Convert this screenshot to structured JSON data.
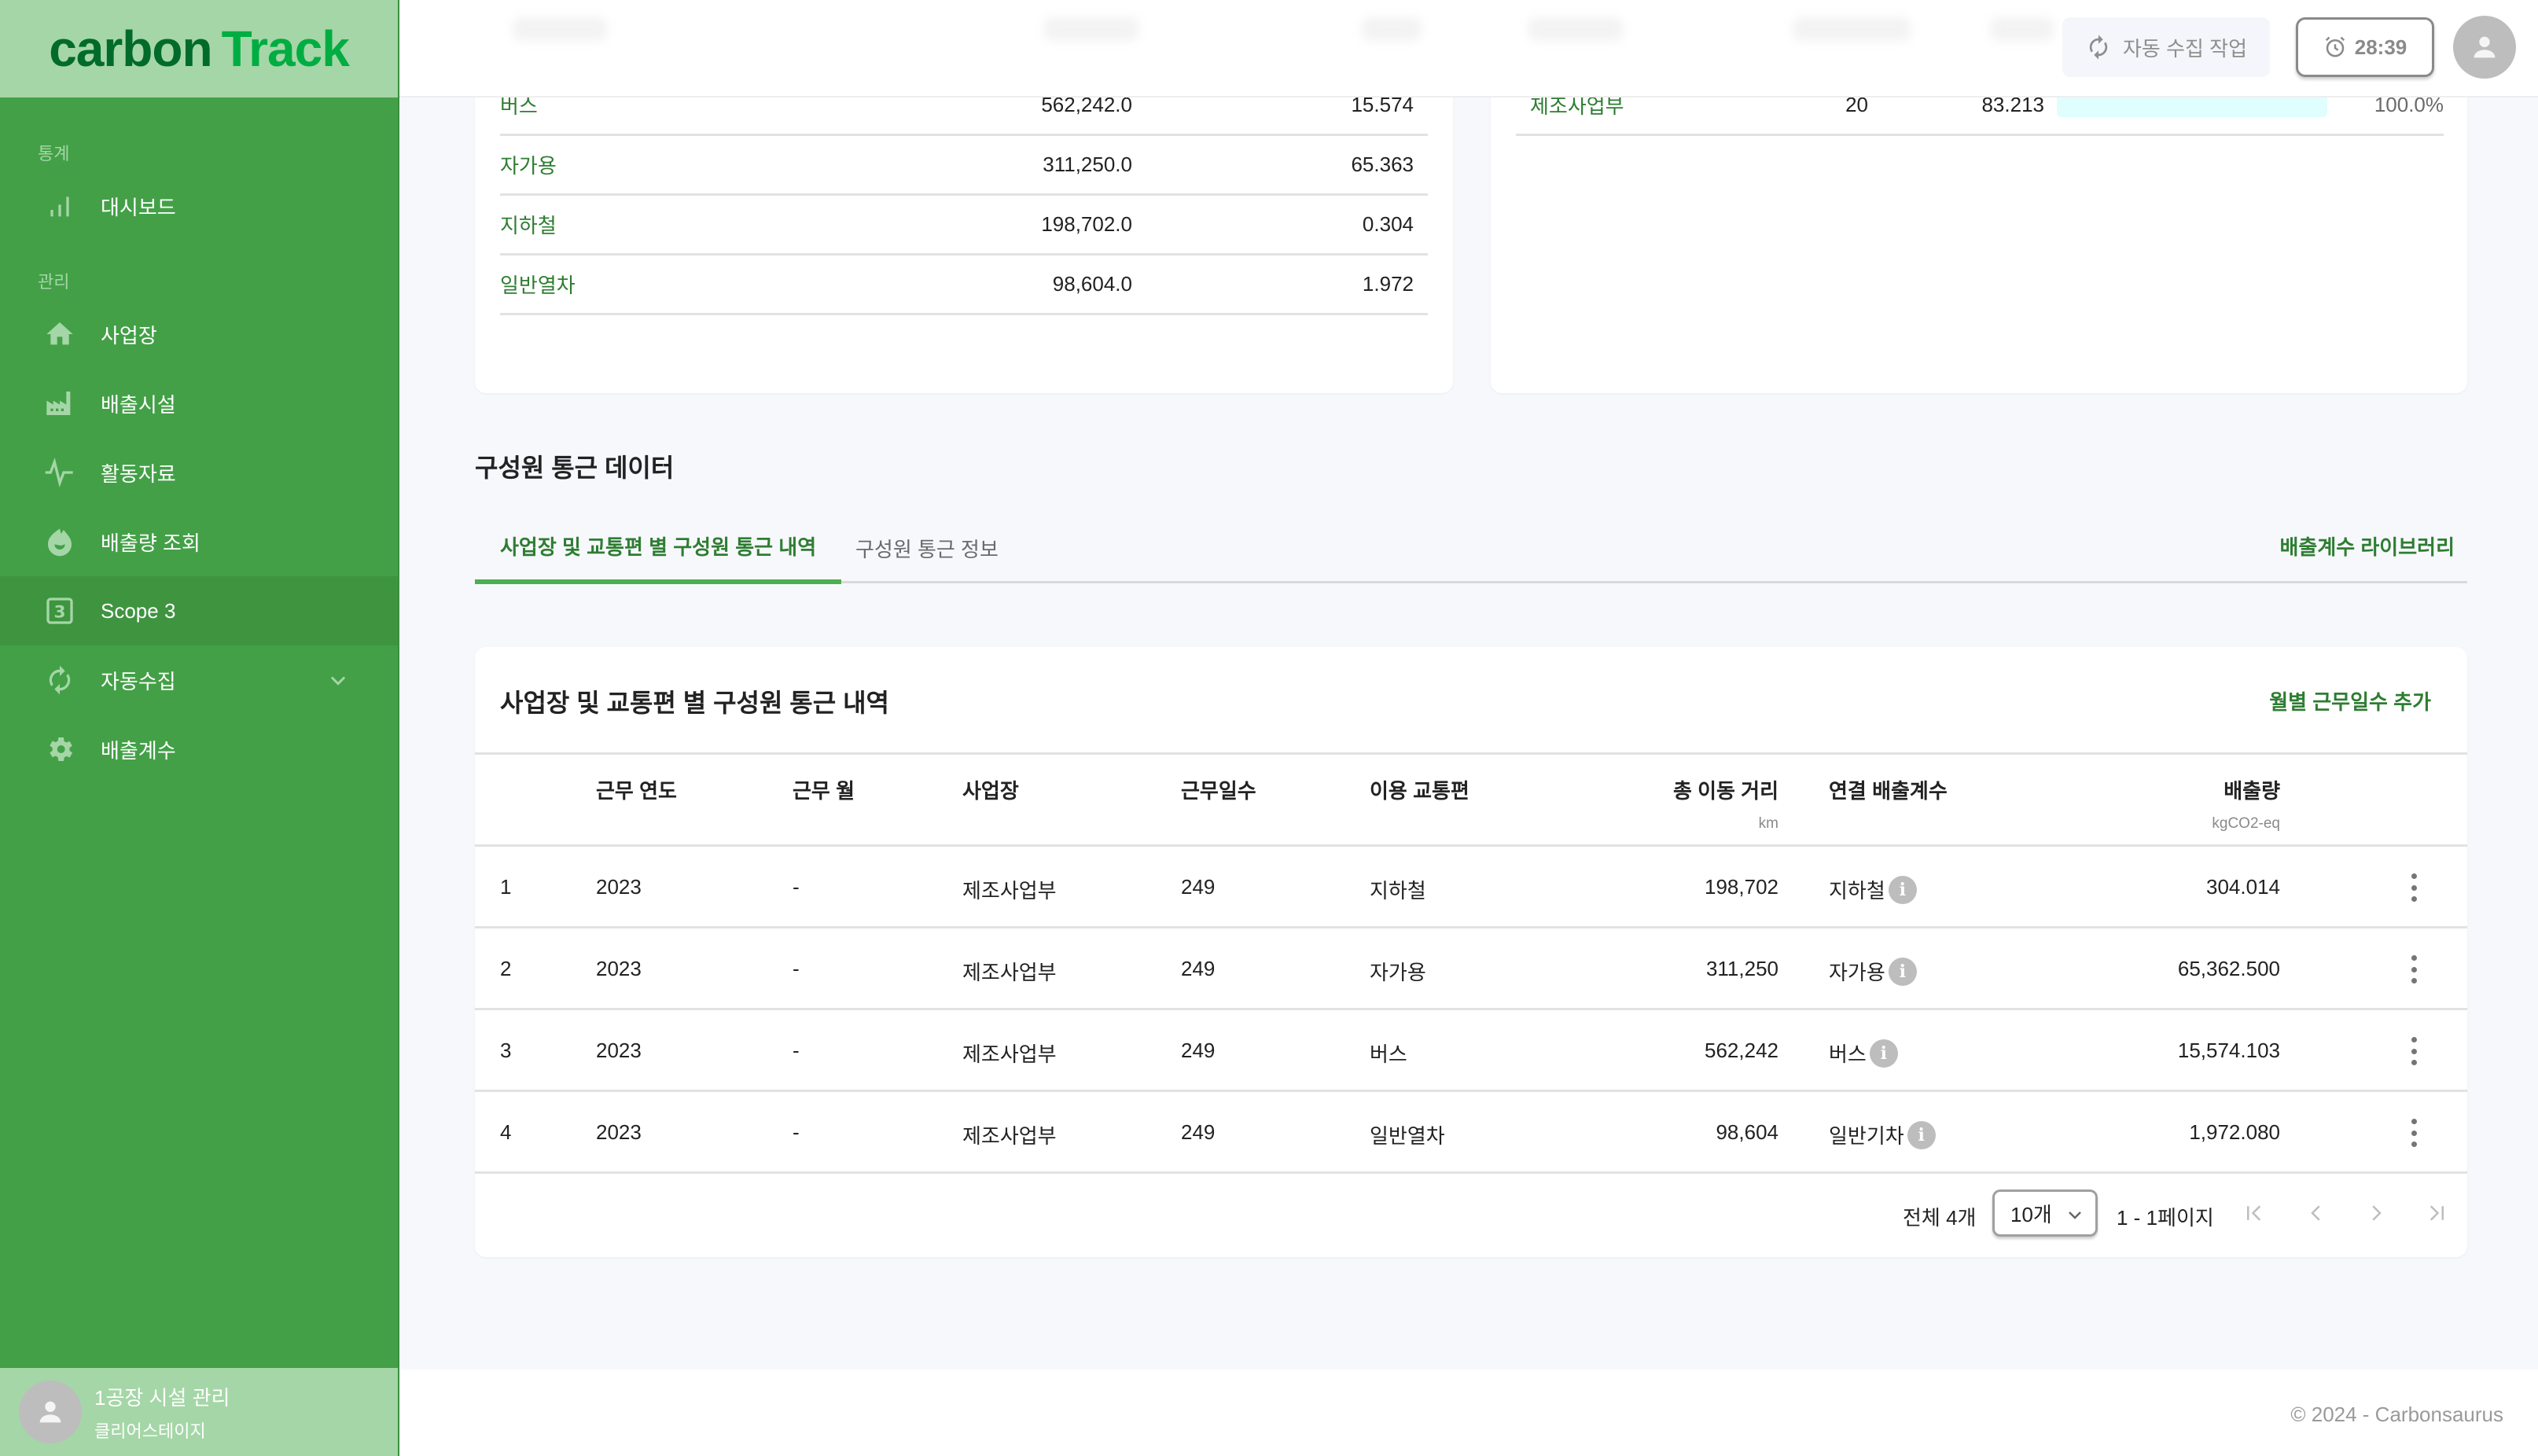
{
  "brand": {
    "part1": "carbon",
    "part2": "Track"
  },
  "sidebar": {
    "sections": [
      {
        "label": "통계"
      },
      {
        "label": "관리"
      }
    ],
    "items": [
      {
        "label": "대시보드",
        "icon": "bar-chart-icon"
      },
      {
        "label": "사업장",
        "icon": "home-icon"
      },
      {
        "label": "배출시설",
        "icon": "factory-icon"
      },
      {
        "label": "활동자료",
        "icon": "activity-icon"
      },
      {
        "label": "배출량 조회",
        "icon": "fire-icon"
      },
      {
        "label": "Scope 3",
        "icon": "scope3-icon",
        "active": true
      },
      {
        "label": "자동수집",
        "icon": "sync-icon",
        "expandable": true
      },
      {
        "label": "배출계수",
        "icon": "gear-icon"
      }
    ],
    "user": {
      "name": "1공장 시설 관리",
      "org": "클리어스테이지"
    }
  },
  "topbar": {
    "auto_collect_label": "자동 수집 작업",
    "timer": "28:39"
  },
  "transport_summary": {
    "rows": [
      {
        "mode": "버스",
        "distance": "562,242.0",
        "emission": "15.574"
      },
      {
        "mode": "자가용",
        "distance": "311,250.0",
        "emission": "65.363"
      },
      {
        "mode": "지하철",
        "distance": "198,702.0",
        "emission": "0.304"
      },
      {
        "mode": "일반열차",
        "distance": "98,604.0",
        "emission": "1.972"
      }
    ]
  },
  "site_summary": {
    "rows": [
      {
        "site": "제조사업부",
        "count": "20",
        "emission": "83.213",
        "share": 100.0,
        "share_label": "100.0%"
      }
    ],
    "bar_color": "#dffefd"
  },
  "section": {
    "title": "구성원 통근 데이터",
    "tabs": [
      {
        "label": "사업장 및 교통편 별 구성원 통근 내역",
        "active": true
      },
      {
        "label": "구성원 통근 정보",
        "active": false
      }
    ],
    "library_link": "배출계수 라이브러리"
  },
  "commute_table": {
    "title": "사업장 및 교통편 별 구성원 통근 내역",
    "add_button": "월별 근무일수 추가",
    "columns": [
      {
        "label": "근무 연도"
      },
      {
        "label": "근무 월"
      },
      {
        "label": "사업장"
      },
      {
        "label": "근무일수"
      },
      {
        "label": "이용 교통편"
      },
      {
        "label": "총 이동 거리",
        "unit": "km"
      },
      {
        "label": "연결 배출계수"
      },
      {
        "label": "배출량",
        "unit": "kgCO2-eq"
      }
    ],
    "rows": [
      {
        "no": "1",
        "year": "2023",
        "month": "-",
        "site": "제조사업부",
        "days": "249",
        "mode": "지하철",
        "distance": "198,702",
        "factor": "지하철",
        "emission": "304.014"
      },
      {
        "no": "2",
        "year": "2023",
        "month": "-",
        "site": "제조사업부",
        "days": "249",
        "mode": "자가용",
        "distance": "311,250",
        "factor": "자가용",
        "emission": "65,362.500"
      },
      {
        "no": "3",
        "year": "2023",
        "month": "-",
        "site": "제조사업부",
        "days": "249",
        "mode": "버스",
        "distance": "562,242",
        "factor": "버스",
        "emission": "15,574.103"
      },
      {
        "no": "4",
        "year": "2023",
        "month": "-",
        "site": "제조사업부",
        "days": "249",
        "mode": "일반열차",
        "distance": "98,604",
        "factor": "일반기차",
        "emission": "1,972.080"
      }
    ],
    "pagination": {
      "total": "전체 4개",
      "page_size": "10개",
      "range": "1 - 1페이지"
    }
  },
  "footer": {
    "copyright": "© 2024 - Carbonsaurus"
  },
  "colors": {
    "sidebar": "#43a047",
    "brand_bg": "#a5d6a7",
    "accent": "#2e7d32",
    "tab_indicator": "#4caf50"
  }
}
